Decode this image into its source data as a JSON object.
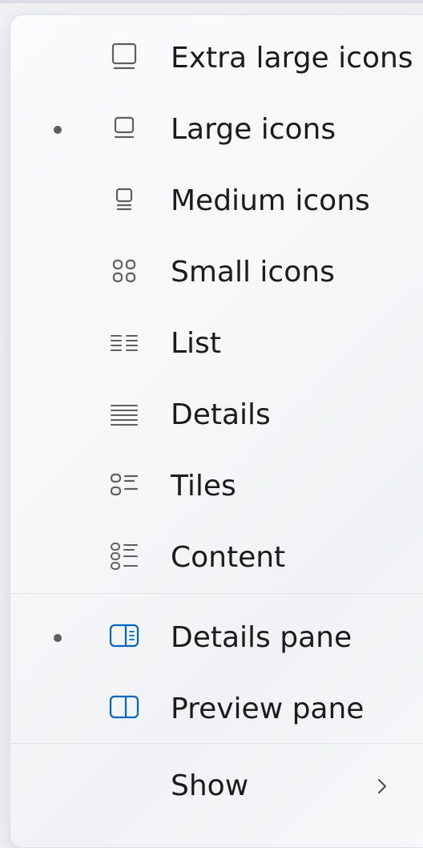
{
  "menu": {
    "items": [
      {
        "label": "Extra large icons",
        "icon": "extra-large-icons-icon",
        "selected": false
      },
      {
        "label": "Large icons",
        "icon": "large-icons-icon",
        "selected": true
      },
      {
        "label": "Medium icons",
        "icon": "medium-icons-icon",
        "selected": false
      },
      {
        "label": "Small icons",
        "icon": "small-icons-icon",
        "selected": false
      },
      {
        "label": "List",
        "icon": "list-icon",
        "selected": false
      },
      {
        "label": "Details",
        "icon": "details-icon",
        "selected": false
      },
      {
        "label": "Tiles",
        "icon": "tiles-icon",
        "selected": false
      },
      {
        "label": "Content",
        "icon": "content-icon",
        "selected": false
      }
    ],
    "pane_items": [
      {
        "label": "Details pane",
        "icon": "details-pane-icon",
        "selected": true
      },
      {
        "label": "Preview pane",
        "icon": "preview-pane-icon",
        "selected": false
      }
    ],
    "show": {
      "label": "Show",
      "icon": "chevron-right-icon"
    }
  },
  "colors": {
    "accent": "#0067c0",
    "icon_gray": "#5f5f5f",
    "text": "#1b1b1b"
  }
}
